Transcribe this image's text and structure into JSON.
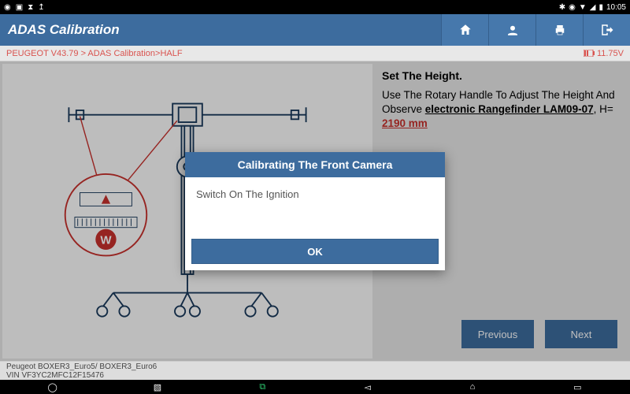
{
  "statusbar": {
    "time": "10:05"
  },
  "appbar": {
    "title": "ADAS Calibration"
  },
  "breadcrumb": {
    "path": "PEUGEOT V43.79 > ADAS Calibration>HALF",
    "voltage": "11.75V"
  },
  "side": {
    "title": "Set The Height.",
    "text_prefix": "Use The Rotary Handle To Adjust The Height And Observe ",
    "link": "electronic Rangefinder LAM09-07",
    "hprefix": ", H= ",
    "hvalue": "2190 mm"
  },
  "buttons": {
    "previous": "Previous",
    "next": "Next"
  },
  "footer": {
    "line1": "Peugeot BOXER3_Euro5/ BOXER3_Euro6",
    "line2": "VIN VF3YC2MFC12F15476"
  },
  "dialog": {
    "title": "Calibrating The Front Camera",
    "body": "Switch On The Ignition",
    "ok": "OK"
  }
}
